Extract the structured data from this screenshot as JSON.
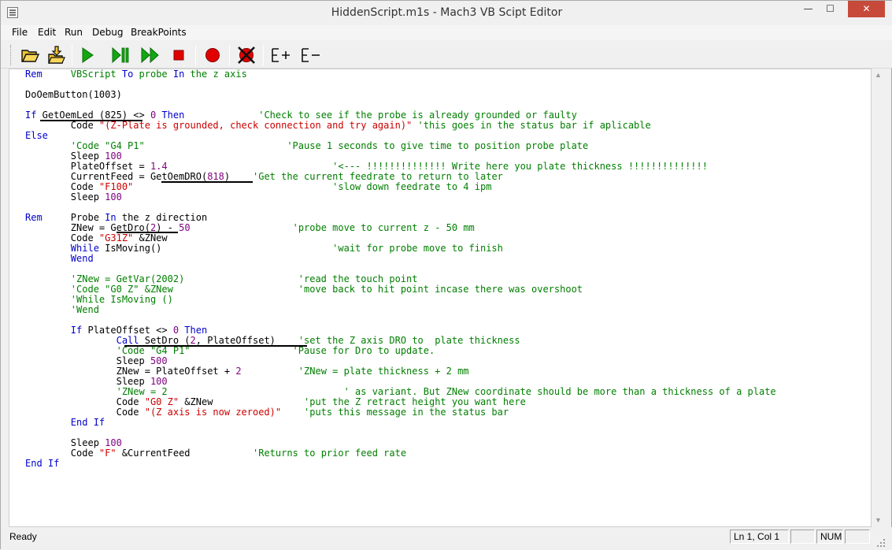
{
  "window": {
    "title": "HiddenScript.m1s - Mach3 VB Scipt Editor",
    "minimize": "—",
    "maximize": "☐",
    "close": "✕"
  },
  "menu": {
    "items": [
      "File",
      "Edit",
      "Run",
      "Debug",
      "BreakPoints"
    ]
  },
  "toolbar": {
    "buttons": [
      {
        "name": "open-file-icon",
        "tooltip": "Open"
      },
      {
        "name": "save-file-icon",
        "tooltip": "Save"
      },
      {
        "name": "run-icon",
        "tooltip": "Run"
      },
      {
        "name": "step-icon",
        "tooltip": "Step"
      },
      {
        "name": "fast-forward-icon",
        "tooltip": "Continue"
      },
      {
        "name": "stop-icon",
        "tooltip": "Stop"
      },
      {
        "name": "breakpoint-icon",
        "tooltip": "Toggle breakpoint"
      },
      {
        "name": "clear-breakpoints-icon",
        "tooltip": "Clear breakpoints"
      },
      {
        "name": "expand-icon",
        "label": "E+"
      },
      {
        "name": "collapse-icon",
        "label": "E-"
      }
    ],
    "colors": {
      "green": "#11a811",
      "red": "#e00000",
      "folder": "#f2c230"
    }
  },
  "editor": {
    "colors": {
      "keyword": "#0000cc",
      "string": "#cc0000",
      "comment": "#007f00",
      "number": "#7f007f"
    },
    "lines": [
      [
        [
          "kw",
          "Rem"
        ],
        [
          "cm",
          "     VBScript "
        ],
        [
          "kw",
          "To"
        ],
        [
          "cm",
          " probe "
        ],
        [
          "kw",
          "In"
        ],
        [
          "cm",
          " the z axis"
        ]
      ],
      [],
      [
        [
          "tx",
          "DoOemButton(1003)"
        ]
      ],
      [],
      [
        [
          "kw",
          "If"
        ],
        [
          "tx",
          " GetOemLed (825) <> "
        ],
        [
          "num",
          "0"
        ],
        [
          "kw",
          " Then"
        ],
        [
          "cm",
          "             'Check to see if the probe is already grounded or faulty"
        ]
      ],
      [
        [
          "tx",
          "        Code "
        ],
        [
          "str",
          "\"(Z-Plate is grounded, check connection and try again)\""
        ],
        [
          "cm",
          " 'this goes in the status bar if aplicable"
        ]
      ],
      [
        [
          "kw",
          "Else"
        ]
      ],
      [
        [
          "cm",
          "        'Code \"G4 P1\"                         'Pause 1 seconds to give time to position probe plate"
        ]
      ],
      [
        [
          "tx",
          "        Sleep "
        ],
        [
          "num",
          "100"
        ]
      ],
      [
        [
          "tx",
          "        PlateOffset = "
        ],
        [
          "num",
          "1.4"
        ],
        [
          "cm",
          "                             '<--- !!!!!!!!!!!!!! Write here you plate thickness !!!!!!!!!!!!!!"
        ]
      ],
      [
        [
          "tx",
          "        CurrentFeed = GetOemDRO("
        ],
        [
          "num",
          "818"
        ],
        [
          "tx",
          ")"
        ],
        [
          "cm",
          "    'Get the current feedrate to return to later"
        ]
      ],
      [
        [
          "tx",
          "        Code "
        ],
        [
          "str",
          "\"F100\""
        ],
        [
          "cm",
          "                                   'slow down feedrate to 4 ipm"
        ]
      ],
      [
        [
          "tx",
          "        Sleep "
        ],
        [
          "num",
          "100"
        ]
      ],
      [],
      [
        [
          "kw",
          "Rem"
        ],
        [
          "tx",
          "     Probe "
        ],
        [
          "kw",
          "In"
        ],
        [
          "tx",
          " the z direction"
        ]
      ],
      [
        [
          "tx",
          "        ZNew = GetDro("
        ],
        [
          "num",
          "2"
        ],
        [
          "tx",
          ") - "
        ],
        [
          "num",
          "50"
        ],
        [
          "cm",
          "                  'probe move to current z - 50 mm"
        ]
      ],
      [
        [
          "tx",
          "        Code "
        ],
        [
          "str",
          "\"G31Z\""
        ],
        [
          "tx",
          " &ZNew"
        ]
      ],
      [
        [
          "kw",
          "        While"
        ],
        [
          "tx",
          " IsMoving()"
        ],
        [
          "cm",
          "                              'wait for probe move to finish"
        ]
      ],
      [
        [
          "kw",
          "        Wend"
        ]
      ],
      [],
      [
        [
          "cm",
          "        'ZNew = GetVar(2002)                    'read the touch point"
        ]
      ],
      [
        [
          "cm",
          "        'Code \"G0 Z\" &ZNew                      'move back to hit point incase there was overshoot"
        ]
      ],
      [
        [
          "cm",
          "        'While IsMoving ()"
        ]
      ],
      [
        [
          "cm",
          "        'Wend"
        ]
      ],
      [],
      [
        [
          "kw",
          "        If"
        ],
        [
          "tx",
          " PlateOffset <> "
        ],
        [
          "num",
          "0"
        ],
        [
          "kw",
          " Then"
        ]
      ],
      [
        [
          "kw",
          "                Call"
        ],
        [
          "tx",
          " SetDro ("
        ],
        [
          "num",
          "2"
        ],
        [
          "tx",
          ", PlateOffset)"
        ],
        [
          "cm",
          "    'set the Z axis DRO to  plate thickness"
        ]
      ],
      [
        [
          "cm",
          "                'Code \"G4 P1\"                  'Pause for Dro to update."
        ]
      ],
      [
        [
          "tx",
          "                Sleep "
        ],
        [
          "num",
          "500"
        ]
      ],
      [
        [
          "tx",
          "                ZNew = PlateOffset + "
        ],
        [
          "num",
          "2"
        ],
        [
          "cm",
          "          'ZNew = plate thickness + 2 mm"
        ]
      ],
      [
        [
          "tx",
          "                Sleep "
        ],
        [
          "num",
          "100"
        ]
      ],
      [
        [
          "cm",
          "                'ZNew = 2                               ' as variant. But ZNew coordinate should be more than a thickness of a plate"
        ]
      ],
      [
        [
          "tx",
          "                Code "
        ],
        [
          "str",
          "\"G0 Z\""
        ],
        [
          "tx",
          " &ZNew"
        ],
        [
          "cm",
          "                'put the Z retract height you want here"
        ]
      ],
      [
        [
          "tx",
          "                Code "
        ],
        [
          "str",
          "\"(Z axis is now zeroed)\""
        ],
        [
          "cm",
          "    'puts this message in the status bar"
        ]
      ],
      [
        [
          "kw",
          "        End If"
        ]
      ],
      [],
      [
        [
          "tx",
          "        Sleep "
        ],
        [
          "num",
          "100"
        ]
      ],
      [
        [
          "tx",
          "        Code "
        ],
        [
          "str",
          "\"F\""
        ],
        [
          "tx",
          " &CurrentFeed"
        ],
        [
          "cm",
          "           'Returns to prior feed rate"
        ]
      ],
      [
        [
          "kw",
          "End If"
        ]
      ]
    ]
  },
  "status": {
    "text": "Ready",
    "position": "Ln 1, Col 1",
    "num": "NUM"
  }
}
